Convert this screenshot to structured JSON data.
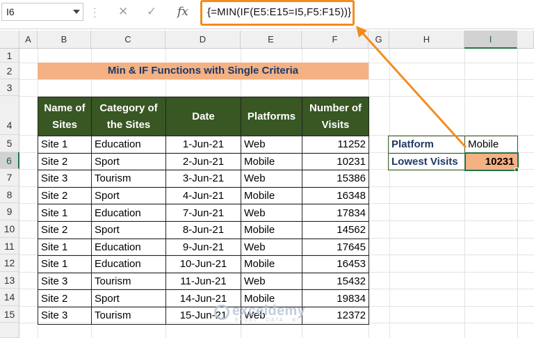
{
  "formula_bar": {
    "name_box": "I6",
    "cancel_icon": "✕",
    "enter_icon": "✓",
    "fx_icon": "fx",
    "formula": "{=MIN(IF(E5:E15=I5,F5:F15))}"
  },
  "columns": [
    "A",
    "B",
    "C",
    "D",
    "E",
    "F",
    "G",
    "H",
    "I"
  ],
  "rows": [
    "1",
    "2",
    "3",
    "4",
    "5",
    "6",
    "7",
    "8",
    "9",
    "10",
    "11",
    "12",
    "13",
    "14",
    "15"
  ],
  "title": "Min & IF Functions with Single Criteria",
  "table": {
    "headers": {
      "site": [
        "Name of",
        "Sites"
      ],
      "category": [
        "Category of",
        "the Sites"
      ],
      "date": "Date",
      "platform": "Platforms",
      "visits": [
        "Number of",
        "Visits"
      ]
    },
    "rows": [
      {
        "site": "Site 1",
        "category": "Education",
        "date": "1-Jun-21",
        "platform": "Web",
        "visits": "11252"
      },
      {
        "site": "Site 2",
        "category": "Sport",
        "date": "2-Jun-21",
        "platform": "Mobile",
        "visits": "10231"
      },
      {
        "site": "Site 3",
        "category": "Tourism",
        "date": "3-Jun-21",
        "platform": "Web",
        "visits": "15386"
      },
      {
        "site": "Site 2",
        "category": "Sport",
        "date": "4-Jun-21",
        "platform": "Mobile",
        "visits": "16348"
      },
      {
        "site": "Site 1",
        "category": "Education",
        "date": "7-Jun-21",
        "platform": "Web",
        "visits": "17834"
      },
      {
        "site": "Site 2",
        "category": "Sport",
        "date": "8-Jun-21",
        "platform": "Mobile",
        "visits": "14562"
      },
      {
        "site": "Site 1",
        "category": "Education",
        "date": "9-Jun-21",
        "platform": "Web",
        "visits": "17645"
      },
      {
        "site": "Site 1",
        "category": "Education",
        "date": "10-Jun-21",
        "platform": "Mobile",
        "visits": "16453"
      },
      {
        "site": "Site 3",
        "category": "Tourism",
        "date": "11-Jun-21",
        "platform": "Web",
        "visits": "15432"
      },
      {
        "site": "Site 2",
        "category": "Sport",
        "date": "14-Jun-21",
        "platform": "Mobile",
        "visits": "19834"
      },
      {
        "site": "Site 3",
        "category": "Tourism",
        "date": "15-Jun-21",
        "platform": "Web",
        "visits": "12372"
      }
    ]
  },
  "lookup": {
    "platform_label": "Platform",
    "platform_value": "Mobile",
    "lowest_label": "Lowest Visits",
    "lowest_value": "10231"
  },
  "watermark": {
    "name": "exceldemy",
    "tagline": "EXCEL · DATA · BI"
  },
  "colors": {
    "header_green": "#385723",
    "title_orange": "#f4b183",
    "annotation_orange": "#f28c1e",
    "selection_green": "#217346"
  }
}
